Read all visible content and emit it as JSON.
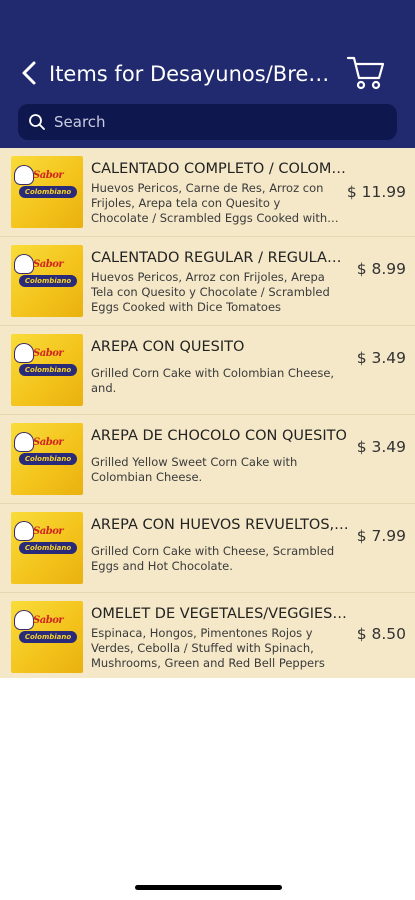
{
  "header": {
    "title": "Items for Desayunos/Breakfast",
    "back_icon": "chevron-left-icon",
    "cart_icon": "shopping-cart-icon",
    "background": "#212a6e"
  },
  "search": {
    "placeholder": "Search",
    "value": "",
    "icon": "search-icon"
  },
  "items": [
    {
      "name": "CALENTADO COMPLETO / COLOMBIAN BREAKFAST",
      "description": "Huevos Pericos, Carne de Res, Arroz con Frijoles, Arepa tela con Quesito y Chocolate / Scrambled Eggs Cooked with Diced Tomatoes",
      "price": "$ 11.99"
    },
    {
      "name": "CALENTADO REGULAR / REGULAR BREAKFAST",
      "description": "Huevos Pericos, Arroz con Frijoles, Arepa Tela con Quesito y Chocolate / Scrambled Eggs Cooked with Dice Tomatoes",
      "price": "$ 8.99"
    },
    {
      "name": "AREPA CON QUESITO",
      "description": "Grilled Corn Cake with Colombian Cheese, and.",
      "price": "$ 3.49"
    },
    {
      "name": "AREPA DE CHOCOLO CON QUESITO",
      "description": "Grilled Yellow Sweet Corn Cake with Colombian Cheese.",
      "price": "$ 3.49"
    },
    {
      "name": "AREPA CON HUEVOS REVUELTOS, QUESO Y CHOCOLATE",
      "description": "Grilled Corn Cake with Cheese, Scrambled Eggs and Hot Chocolate.",
      "price": "$ 7.99"
    },
    {
      "name": "OMELET DE VEGETALES/VEGGIES OMELET",
      "description": "Espinaca, Hongos, Pimentones Rojos y Verdes, Cebolla / Stuffed with Spinach, Mushrooms, Green and Red Bell Peppers",
      "price": "$ 8.50"
    }
  ],
  "colors": {
    "list_background": "#f5e8c8",
    "search_background": "#0f174f"
  }
}
